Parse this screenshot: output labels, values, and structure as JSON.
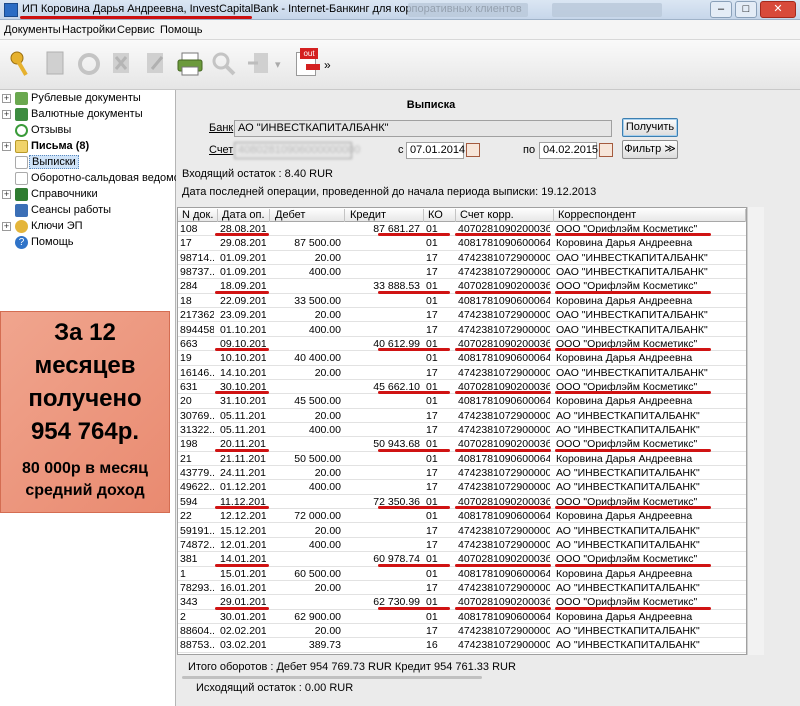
{
  "window": {
    "title": "ИП Коровина Дарья Андреевна, InvestCapitalBank - Internet-Банкинг для корпоративных клиентов",
    "minimize": "–",
    "maximize": "□",
    "close": "✕"
  },
  "menu": [
    "Документы",
    "Настройки",
    "Сервис",
    "Помощь"
  ],
  "toolbar": {
    "out_label": "out",
    "more": "»"
  },
  "sidebar": {
    "items": [
      {
        "label": "Рублевые документы",
        "exp": "+"
      },
      {
        "label": "Валютные документы",
        "exp": "+"
      },
      {
        "label": "Отзывы",
        "exp": ""
      },
      {
        "label": "Письма (8)",
        "exp": "+"
      },
      {
        "label": "Выписки",
        "exp": ""
      },
      {
        "label": "Оборотно-сальдовая ведомость",
        "exp": ""
      },
      {
        "label": "Справочники",
        "exp": "+"
      },
      {
        "label": "Сеансы работы",
        "exp": ""
      },
      {
        "label": "Ключи ЭП",
        "exp": "+"
      },
      {
        "label": "Помощь",
        "exp": ""
      }
    ]
  },
  "promo": {
    "line1": "За 12",
    "line2": "месяцев",
    "line3": "получено",
    "line4": "954 764р.",
    "line5": "80 000р в месяц",
    "line6": "средний доход"
  },
  "statement": {
    "heading": "Выписка",
    "bank_label": "Банк",
    "bank_value": "АО \"ИНВЕСТКАПИТАЛБАНК\"",
    "get_button": "Получить",
    "account_label": "Счет",
    "account_value": "40802810906000000000",
    "from_label": "с",
    "from_value": "07.01.2014",
    "to_label": "по",
    "to_value": "04.02.2015",
    "filter_button": "Фильтр ≫",
    "opening_balance": "Входящий остаток :  8.40  RUR",
    "last_op": "Дата последней операции, проведенной до начала периода выписки: 19.12.2013"
  },
  "grid": {
    "columns": [
      "N док.",
      "Дата оп.",
      "Дебет",
      "Кредит",
      "КО",
      "Счет корр.",
      "Корреспондент"
    ],
    "rows": [
      [
        "108",
        "28.08.2014",
        "",
        "87 681.27",
        "01",
        "407028109020003б...",
        "ООО \"Орифлэйм Косметикс\""
      ],
      [
        "17",
        "29.08.2014",
        "87 500.00",
        "",
        "01",
        "4081781090600064...",
        "Коровина Дарья Андреевна"
      ],
      [
        "98714...",
        "01.09.2014",
        "20.00",
        "",
        "17",
        "4742381072900000...",
        "ОАО \"ИНВЕСТКАПИТАЛБАНК\""
      ],
      [
        "98737...",
        "01.09.2014",
        "400.00",
        "",
        "17",
        "4742381072900000...",
        "ОАО \"ИНВЕСТКАПИТАЛБАНК\""
      ],
      [
        "284",
        "18.09.2014",
        "",
        "33 888.53",
        "01",
        "407028109020003б...",
        "ООО \"Орифлэйм Косметикс\""
      ],
      [
        "18",
        "22.09.2014",
        "33 500.00",
        "",
        "01",
        "4081781090600064...",
        "Коровина Дарья Андреевна"
      ],
      [
        "217362",
        "23.09.2014",
        "20.00",
        "",
        "17",
        "4742381072900000...",
        "ОАО \"ИНВЕСТКАПИТАЛБАНК\""
      ],
      [
        "894458",
        "01.10.2014",
        "400.00",
        "",
        "17",
        "4742381072900000...",
        "ОАО \"ИНВЕСТКАПИТАЛБАНК\""
      ],
      [
        "663",
        "09.10.2014",
        "",
        "40 612.99",
        "01",
        "407028109020003б...",
        "ООО \"Орифлэйм Косметикс\""
      ],
      [
        "19",
        "10.10.2014",
        "40 400.00",
        "",
        "01",
        "4081781090600064...",
        "Коровина Дарья Андреевна"
      ],
      [
        "16146...",
        "14.10.2014",
        "20.00",
        "",
        "17",
        "4742381072900000...",
        "ОАО \"ИНВЕСТКАПИТАЛБАНК\""
      ],
      [
        "631",
        "30.10.2014",
        "",
        "45 662.10",
        "01",
        "407028109020003б...",
        "ООО \"Орифлэйм Косметикс\""
      ],
      [
        "20",
        "31.10.2014",
        "45 500.00",
        "",
        "01",
        "4081781090600064...",
        "Коровина Дарья Андреевна"
      ],
      [
        "30769...",
        "05.11.2014",
        "20.00",
        "",
        "17",
        "4742381072900000...",
        "АО \"ИНВЕСТКАПИТАЛБАНК\""
      ],
      [
        "31322...",
        "05.11.2014",
        "400.00",
        "",
        "17",
        "4742381072900000...",
        "АО \"ИНВЕСТКАПИТАЛБАНК\""
      ],
      [
        "198",
        "20.11.2014",
        "",
        "50 943.68",
        "01",
        "407028109020003б...",
        "ООО \"Орифлэйм Косметикс\""
      ],
      [
        "21",
        "21.11.2014",
        "50 500.00",
        "",
        "01",
        "4081781090600064...",
        "Коровина Дарья Андреевна"
      ],
      [
        "43779...",
        "24.11.2014",
        "20.00",
        "",
        "17",
        "4742381072900000...",
        "АО \"ИНВЕСТКАПИТАЛБАНК\""
      ],
      [
        "49622...",
        "01.12.2014",
        "400.00",
        "",
        "17",
        "4742381072900000...",
        "АО \"ИНВЕСТКАПИТАЛБАНК\""
      ],
      [
        "594",
        "11.12.2014",
        "",
        "72 350.36",
        "01",
        "407028109020003б...",
        "ООО \"Орифлэйм Косметикс\""
      ],
      [
        "22",
        "12.12.2014",
        "72 000.00",
        "",
        "01",
        "4081781090600064...",
        "Коровина Дарья Андреевна"
      ],
      [
        "59191...",
        "15.12.2014",
        "20.00",
        "",
        "17",
        "4742381072900000...",
        "АО \"ИНВЕСТКАПИТАЛБАНК\""
      ],
      [
        "74872...",
        "12.01.2015",
        "400.00",
        "",
        "17",
        "4742381072900000...",
        "АО \"ИНВЕСТКАПИТАЛБАНК\""
      ],
      [
        "381",
        "14.01.2015",
        "",
        "60 978.74",
        "01",
        "407028109020003б...",
        "ООО \"Орифлэйм Косметикс\""
      ],
      [
        "1",
        "15.01.2015",
        "60 500.00",
        "",
        "01",
        "4081781090600064...",
        "Коровина Дарья Андреевна"
      ],
      [
        "78293...",
        "16.01.2015",
        "20.00",
        "",
        "17",
        "4742381072900000...",
        "АО \"ИНВЕСТКАПИТАЛБАНК\""
      ],
      [
        "343",
        "29.01.2015",
        "",
        "62 730.99",
        "01",
        "407028109020003б...",
        "ООО \"Орифлэйм Косметикс\""
      ],
      [
        "2",
        "30.01.2015",
        "62 900.00",
        "",
        "01",
        "4081781090600064...",
        "Коровина Дарья Андреевна"
      ],
      [
        "88604...",
        "02.02.2015",
        "20.00",
        "",
        "17",
        "4742381072900000...",
        "АО \"ИНВЕСТКАПИТАЛБАНК\""
      ],
      [
        "88753...",
        "03.02.2015",
        "389.73",
        "",
        "16",
        "4742381072900000...",
        "АО \"ИНВЕСТКАПИТАЛБАНК\""
      ]
    ]
  },
  "totals": "Итого оборотов :  Дебет  954 769.73  RUR  Кредит  954 761.33  RUR",
  "closing_balance": "Исходящий остаток :  0.00  RUR"
}
